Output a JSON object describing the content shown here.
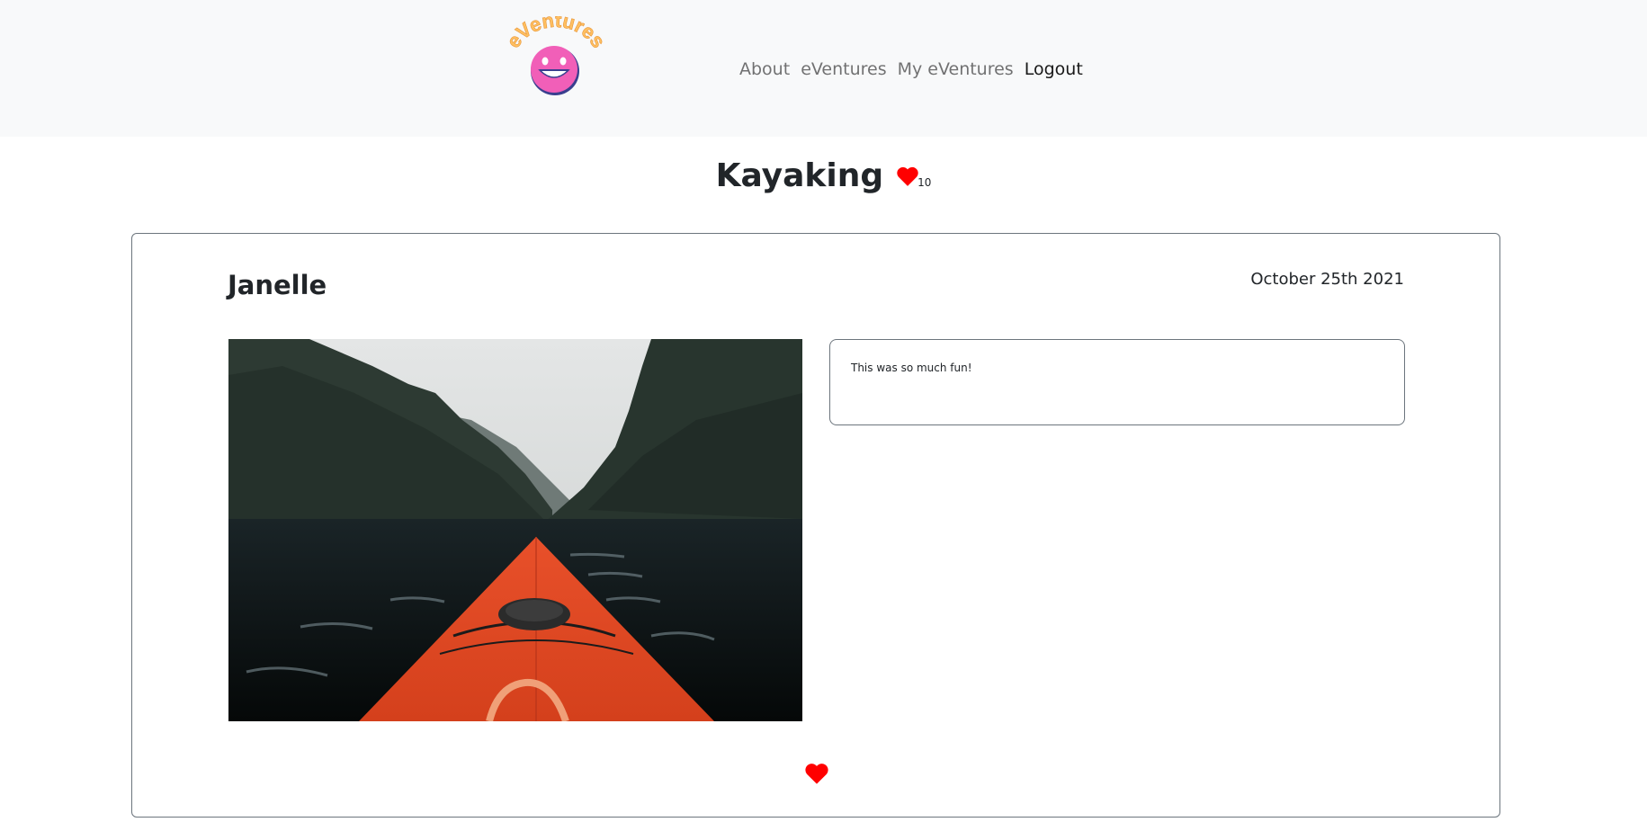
{
  "navbar": {
    "logo_text": "eVentures",
    "links": [
      {
        "label": "About"
      },
      {
        "label": "eVentures"
      },
      {
        "label": "My eVentures"
      },
      {
        "label": "Logout"
      }
    ]
  },
  "page": {
    "title": "Kayaking",
    "like_count": "10"
  },
  "post": {
    "author": "Janelle",
    "date": "October 25th 2021",
    "comment": "This was so much fun!",
    "image_icon": "kayak-photo"
  },
  "colors": {
    "navbar_bg": "#f8f9fa",
    "heart": "#ff0000",
    "logo_face": "#f15fb8",
    "logo_text": "#ffc061"
  }
}
